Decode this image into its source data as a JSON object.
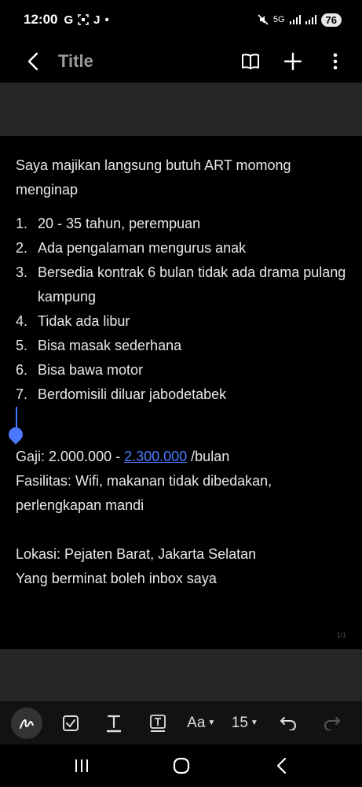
{
  "status": {
    "time": "12:00",
    "network_label": "5G",
    "battery": "76"
  },
  "header": {
    "title": "Title"
  },
  "note": {
    "intro": "Saya majikan langsung butuh ART momong menginap",
    "list": [
      {
        "num": "1.",
        "text": "20 - 35 tahun, perempuan"
      },
      {
        "num": "2.",
        "text": "Ada pengalaman mengurus anak"
      },
      {
        "num": "3.",
        "text": "Bersedia kontrak 6 bulan tidak ada drama pulang kampung"
      },
      {
        "num": "4.",
        "text": "Tidak ada libur"
      },
      {
        "num": "5.",
        "text": "Bisa masak sederhana"
      },
      {
        "num": "6.",
        "text": "Bisa bawa motor"
      },
      {
        "num": "7.",
        "text": "Berdomisili diluar jabodetabek"
      }
    ],
    "salary_prefix": "Gaji: 2.000.000 - ",
    "salary_link": "2.300.000",
    "salary_suffix": " /bulan",
    "facilities": "Fasilitas: Wifi, makanan tidak dibedakan, perlengkapan mandi",
    "location": "Lokasi: Pejaten Barat, Jakarta Selatan",
    "contact": "Yang berminat boleh inbox saya",
    "page_indicator": "1/1"
  },
  "toolbar": {
    "font_label": "Aa",
    "size_label": "15"
  },
  "colors": {
    "accent": "#4a78ff",
    "background": "#000000",
    "band": "#262626"
  }
}
